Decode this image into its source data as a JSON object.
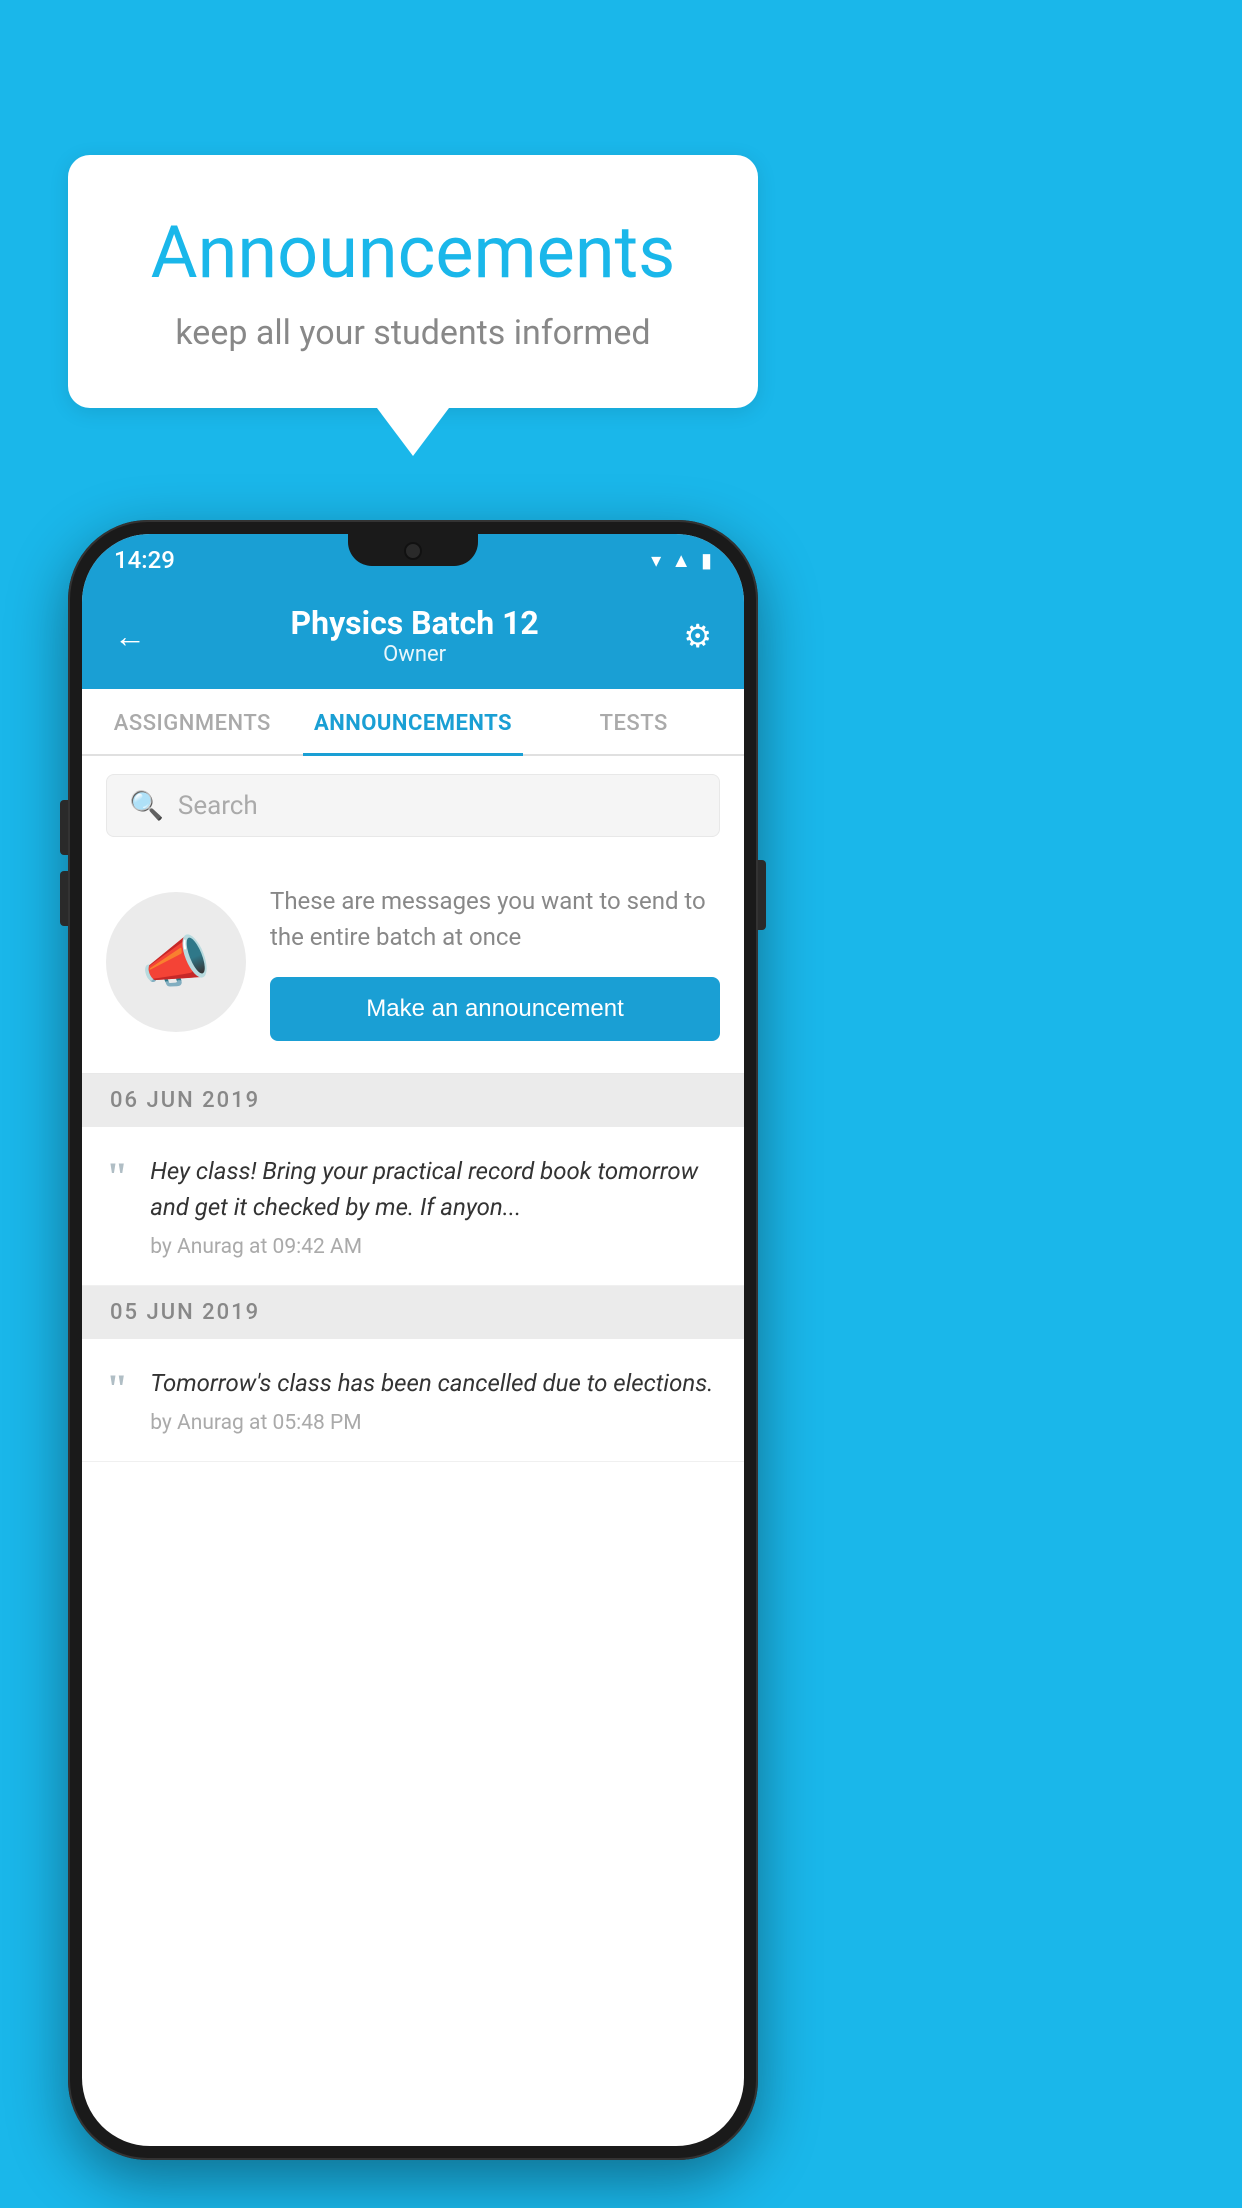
{
  "background_color": "#1ab7ea",
  "speech_bubble": {
    "title": "Announcements",
    "subtitle": "keep all your students informed"
  },
  "phone": {
    "status_bar": {
      "time": "14:29",
      "icons": [
        "wifi",
        "signal",
        "battery"
      ]
    },
    "header": {
      "back_label": "←",
      "title": "Physics Batch 12",
      "subtitle": "Owner",
      "gear_label": "⚙"
    },
    "tabs": [
      {
        "label": "ASSIGNMENTS",
        "active": false
      },
      {
        "label": "ANNOUNCEMENTS",
        "active": true
      },
      {
        "label": "TESTS",
        "active": false
      }
    ],
    "search": {
      "placeholder": "Search"
    },
    "promo": {
      "description": "These are messages you want to send to the entire batch at once",
      "button_label": "Make an announcement"
    },
    "announcements": [
      {
        "date": "06  JUN  2019",
        "items": [
          {
            "text": "Hey class! Bring your practical record book tomorrow and get it checked by me. If anyon...",
            "author": "by Anurag at 09:42 AM"
          }
        ]
      },
      {
        "date": "05  JUN  2019",
        "items": [
          {
            "text": "Tomorrow's class has been cancelled due to elections.",
            "author": "by Anurag at 05:48 PM"
          }
        ]
      }
    ]
  }
}
